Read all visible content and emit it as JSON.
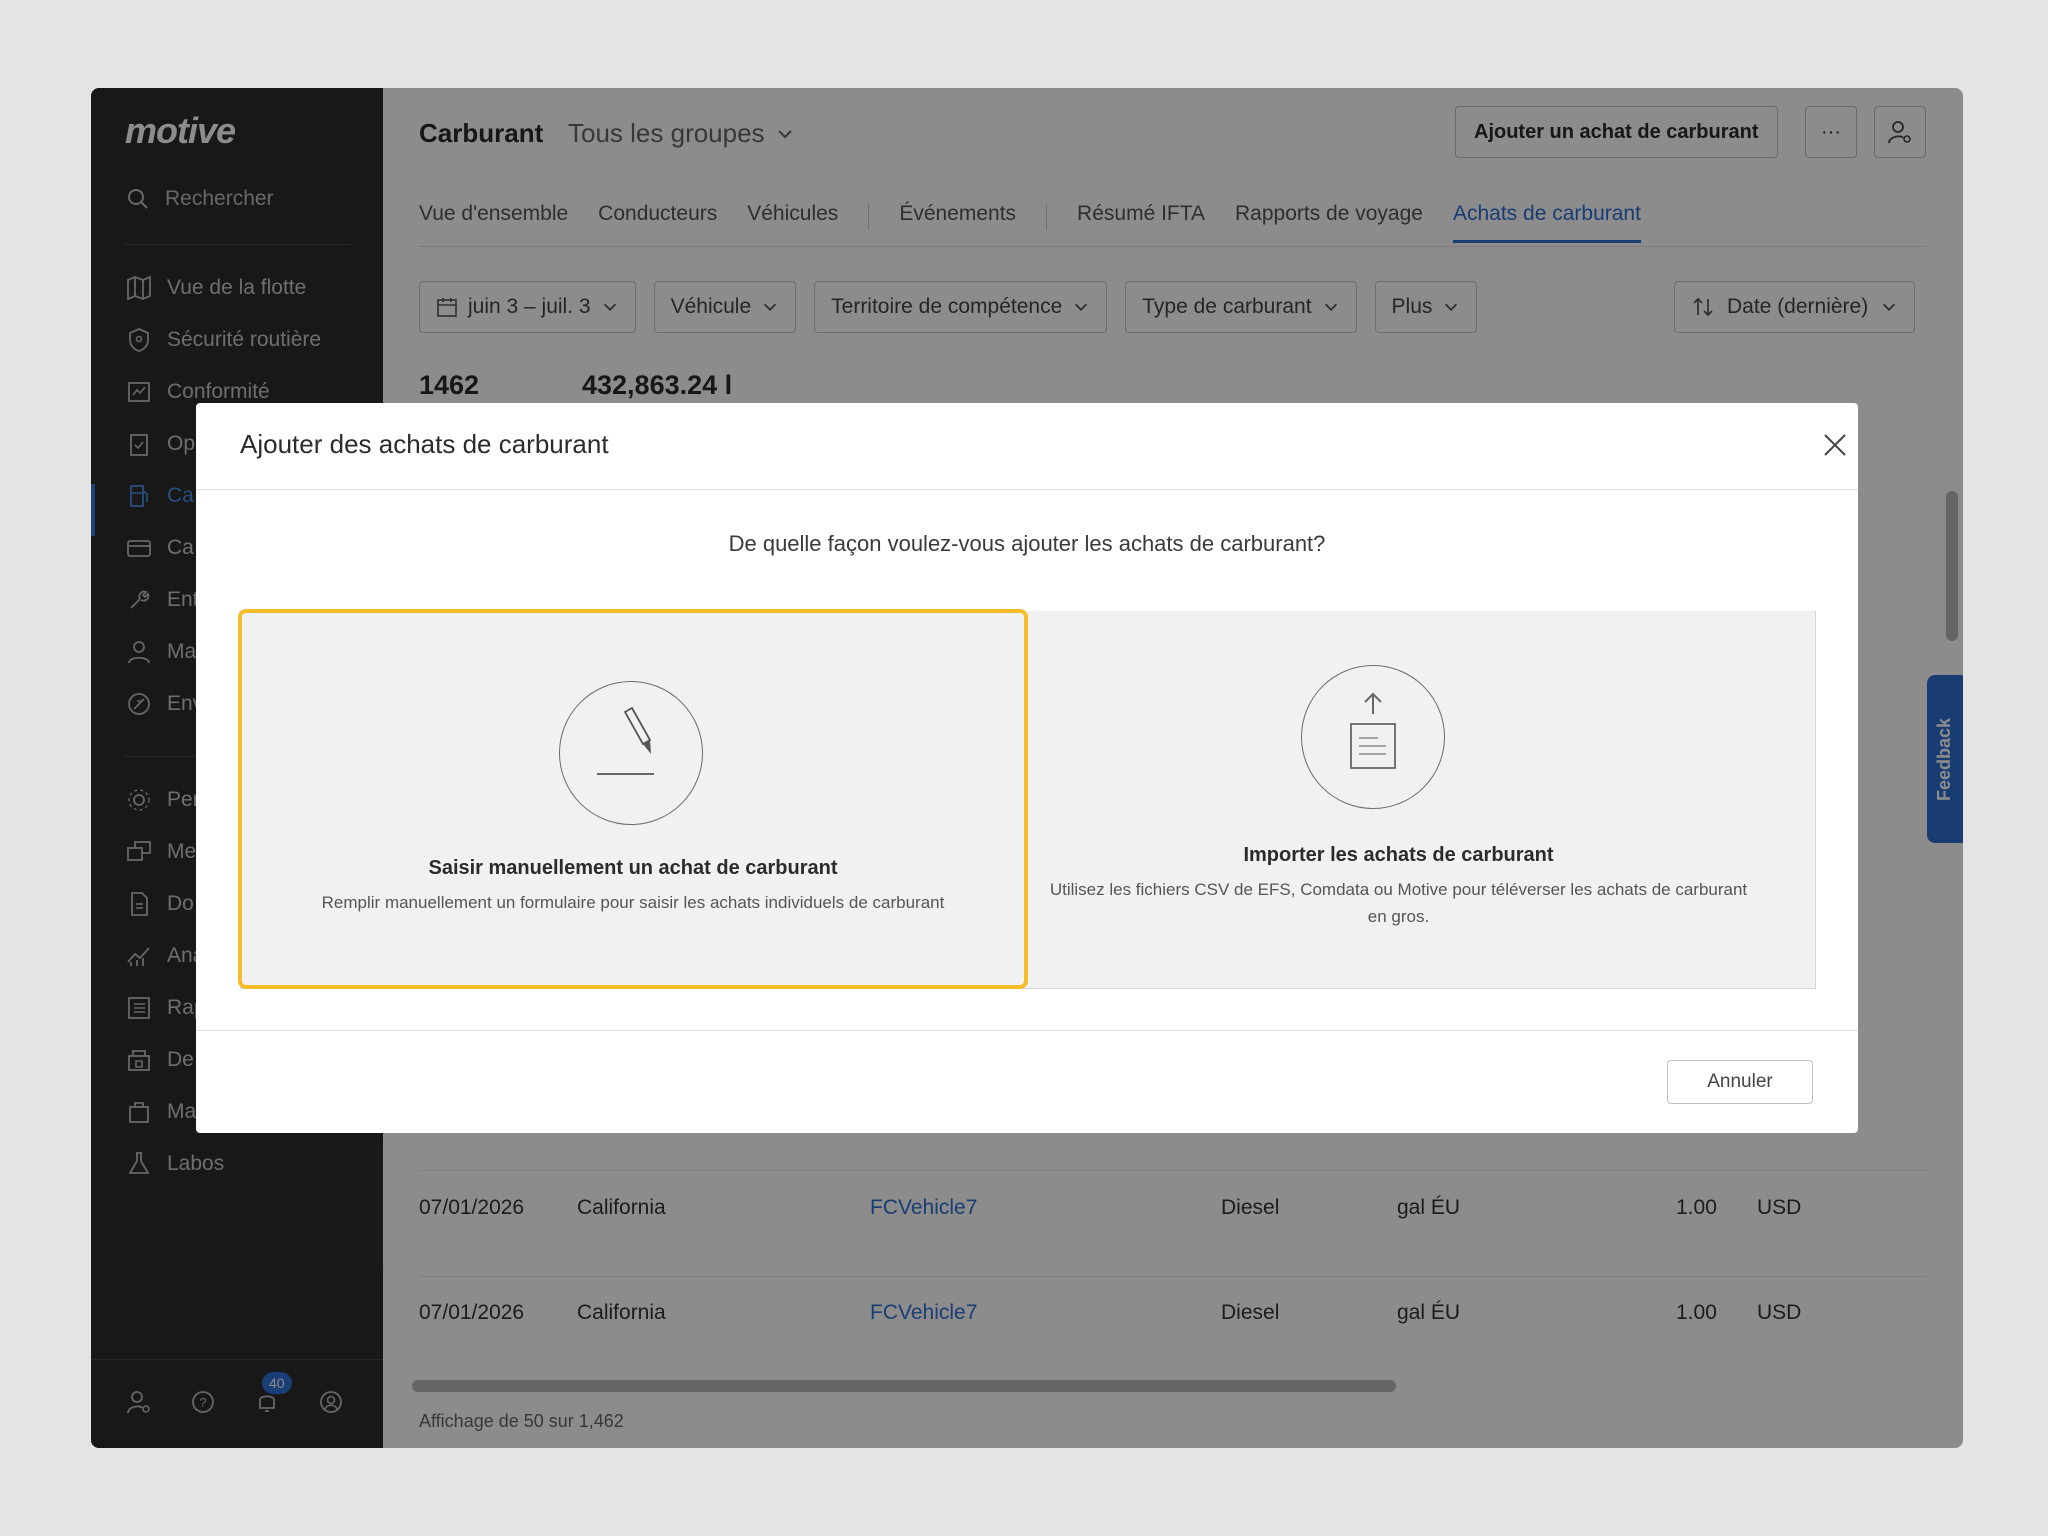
{
  "app": {
    "logo": "motive",
    "search_label": "Rechercher",
    "nav_items": [
      {
        "label": "Vue de la flotte",
        "icon": "map-icon"
      },
      {
        "label": "Sécurité routière",
        "icon": "shield-icon"
      },
      {
        "label": "Conformité",
        "icon": "compliance-icon"
      },
      {
        "label": "Op",
        "icon": "clipboard-icon"
      },
      {
        "label": "Ca",
        "icon": "fuel-icon"
      },
      {
        "label": "Ca",
        "icon": "card-icon"
      },
      {
        "label": "Ent",
        "icon": "wrench-icon"
      },
      {
        "label": "Ma",
        "icon": "person-icon"
      },
      {
        "label": "Env",
        "icon": "leaf-icon"
      },
      {
        "label": "Per",
        "icon": "gear-people-icon"
      },
      {
        "label": "Me",
        "icon": "messages-icon"
      },
      {
        "label": "Do",
        "icon": "document-icon"
      },
      {
        "label": "Ana",
        "icon": "analytics-icon"
      },
      {
        "label": "Rap",
        "icon": "reports-icon"
      },
      {
        "label": "De",
        "icon": "store-icon"
      },
      {
        "label": "Ma",
        "icon": "bag-icon"
      },
      {
        "label": "Labos",
        "icon": "flask-icon"
      }
    ],
    "notification_count": "40"
  },
  "header": {
    "title": "Carburant",
    "group_selector": "Tous les groupes",
    "add_button": "Ajouter un achat de carburant",
    "more_label": "···"
  },
  "tabs": [
    "Vue d'ensemble",
    "Conducteurs",
    "Véhicules",
    "Événements",
    "Résumé IFTA",
    "Rapports de voyage",
    "Achats de carburant"
  ],
  "active_tab": "Achats de carburant",
  "filters": {
    "date": "juin 3 – juil. 3",
    "vehicle": "Véhicule",
    "jurisdiction": "Territoire de compétence",
    "fuel_type": "Type de carburant",
    "more": "Plus",
    "sort": "Date (dernière)"
  },
  "stats": {
    "count": "1462",
    "volume": "432,863.24 l"
  },
  "table": {
    "rows": [
      {
        "date": "07/01/2026",
        "state": "California",
        "vehicle": "FCVehicle7",
        "fuel": "Diesel",
        "unit": "gal ÉU",
        "qty": "1.00",
        "currency": "USD"
      },
      {
        "date": "07/01/2026",
        "state": "California",
        "vehicle": "FCVehicle7",
        "fuel": "Diesel",
        "unit": "gal ÉU",
        "qty": "1.00",
        "currency": "USD"
      }
    ],
    "footer": "Affichage de 50 sur 1,462"
  },
  "feedback_label": "Feedback",
  "modal": {
    "title": "Ajouter des achats de carburant",
    "question": "De quelle façon voulez-vous ajouter les achats de carburant?",
    "options": [
      {
        "title": "Saisir manuellement un achat de carburant",
        "description": "Remplir manuellement un formulaire pour saisir les achats individuels de carburant",
        "icon": "pencil-icon",
        "selected": true
      },
      {
        "title": "Importer les achats de carburant",
        "description": "Utilisez les fichiers CSV de EFS, Comdata ou Motive pour téléverser les achats de carburant en gros.",
        "icon": "upload-document-icon",
        "selected": false
      }
    ],
    "cancel_label": "Annuler"
  },
  "colors": {
    "accent": "#2f6fd1",
    "selection_outline": "#f5bd2a",
    "sidebar_bg": "#2d2d2d"
  }
}
